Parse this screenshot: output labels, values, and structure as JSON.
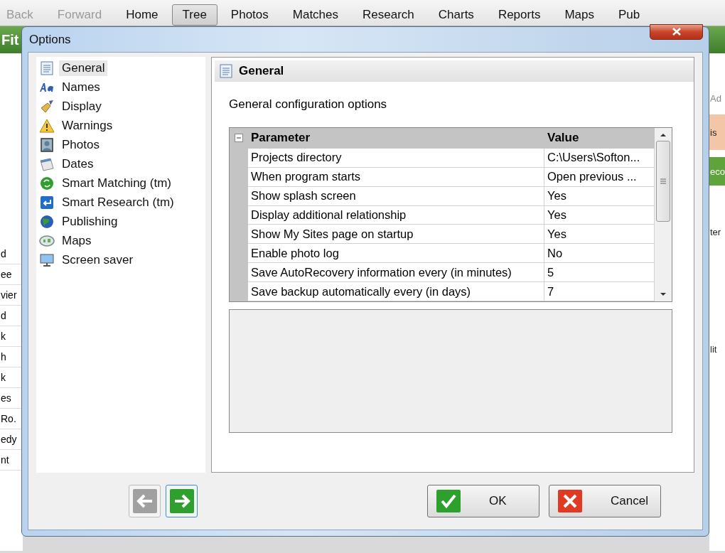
{
  "toolbar": {
    "items": [
      {
        "label": "Back",
        "selected": false,
        "disabled": true
      },
      {
        "label": "Forward",
        "selected": false,
        "disabled": true
      },
      {
        "label": "Home",
        "selected": false,
        "disabled": false
      },
      {
        "label": "Tree",
        "selected": true,
        "disabled": false
      },
      {
        "label": "Photos",
        "selected": false,
        "disabled": false
      },
      {
        "label": "Matches",
        "selected": false,
        "disabled": false
      },
      {
        "label": "Research",
        "selected": false,
        "disabled": false
      },
      {
        "label": "Charts",
        "selected": false,
        "disabled": false
      },
      {
        "label": "Reports",
        "selected": false,
        "disabled": false
      },
      {
        "label": "Maps",
        "selected": false,
        "disabled": false
      },
      {
        "label": "Pub",
        "selected": false,
        "disabled": false
      }
    ]
  },
  "background": {
    "header_text": "Fit",
    "left_column": [
      "d",
      "ee",
      "vier",
      "d",
      "k",
      "h",
      "k",
      "es",
      "Ro.",
      "edy",
      "nt"
    ],
    "right_column": [
      "Ad",
      "is",
      "eco",
      "ter",
      "lit"
    ]
  },
  "dialog": {
    "title": "Options",
    "nav_items": [
      {
        "label": "General",
        "kind": "page",
        "selected": true
      },
      {
        "label": "Names",
        "kind": "letters",
        "selected": false
      },
      {
        "label": "Display",
        "kind": "brush",
        "selected": false
      },
      {
        "label": "Warnings",
        "kind": "warning",
        "selected": false
      },
      {
        "label": "Photos",
        "kind": "portrait",
        "selected": false
      },
      {
        "label": "Dates",
        "kind": "calendar",
        "selected": false
      },
      {
        "label": "Smart Matching (tm)",
        "kind": "recycle",
        "selected": false
      },
      {
        "label": "Smart Research (tm)",
        "kind": "arrow",
        "selected": false
      },
      {
        "label": "Publishing",
        "kind": "globe",
        "selected": false
      },
      {
        "label": "Maps",
        "kind": "map",
        "selected": false
      },
      {
        "label": "Screen saver",
        "kind": "monitor",
        "selected": false
      }
    ],
    "panel_title": "General",
    "description": "General configuration options",
    "grid": {
      "columns": [
        "Parameter",
        "Value"
      ],
      "expanded": true,
      "rows": [
        {
          "parameter": "Projects directory",
          "value": "C:\\Users\\Softon..."
        },
        {
          "parameter": "When program starts",
          "value": "Open previous ..."
        },
        {
          "parameter": "Show splash screen",
          "value": "Yes"
        },
        {
          "parameter": "Display additional relationship",
          "value": "Yes"
        },
        {
          "parameter": "Show My Sites page on startup",
          "value": "Yes"
        },
        {
          "parameter": "Enable photo log",
          "value": "No"
        },
        {
          "parameter": "Save AutoRecovery information every (in minutes)",
          "value": "5"
        },
        {
          "parameter": "Save backup automatically every (in days)",
          "value": "7"
        }
      ]
    },
    "back_enabled": false,
    "forward_enabled": true,
    "buttons": [
      {
        "label": "OK",
        "kind": "ok"
      },
      {
        "label": "Cancel",
        "kind": "cancel"
      }
    ]
  }
}
